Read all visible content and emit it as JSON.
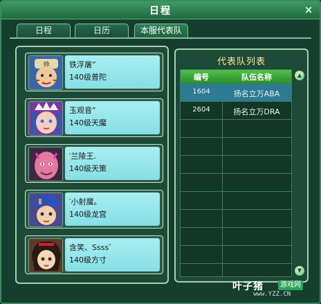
{
  "window": {
    "title": "日程",
    "close_symbol": "×"
  },
  "tabs": [
    {
      "label": "日程",
      "active": false
    },
    {
      "label": "日历",
      "active": false
    },
    {
      "label": "本服代表队",
      "active": true
    }
  ],
  "members": [
    {
      "name": "铁浮屠”",
      "level": "140级普陀",
      "avatar": "warrior-portrait"
    },
    {
      "name": "玉观音”",
      "level": "140级天魔",
      "avatar": "demon-girl-portrait"
    },
    {
      "name": "′兰陵王.",
      "level": "140级天策",
      "avatar": "pink-demon-portrait"
    },
    {
      "name": "′小射魔。",
      "level": "140级龙宫",
      "avatar": "dragon-boy-portrait"
    },
    {
      "name": "含笑、Ssss゛",
      "level": "140级方寸",
      "avatar": "girl-portrait"
    }
  ],
  "team_list": {
    "title": "代表队列表",
    "headers": {
      "id": "编号",
      "name": "队伍名称"
    },
    "rows": [
      {
        "id": "1604",
        "name": "扬名立万ABA",
        "selected": true
      },
      {
        "id": "2604",
        "name": "扬名立万DRA",
        "selected": false
      }
    ]
  },
  "watermark": {
    "main": "叶子猪",
    "badge": "游戏网",
    "url": "www.YZZ.CN"
  },
  "colors": {
    "accent_green": "#3c8a5a",
    "info_cyan": "#86dfe5",
    "title_gold": "#ffe79a",
    "selected_row": "#2d7a93"
  }
}
